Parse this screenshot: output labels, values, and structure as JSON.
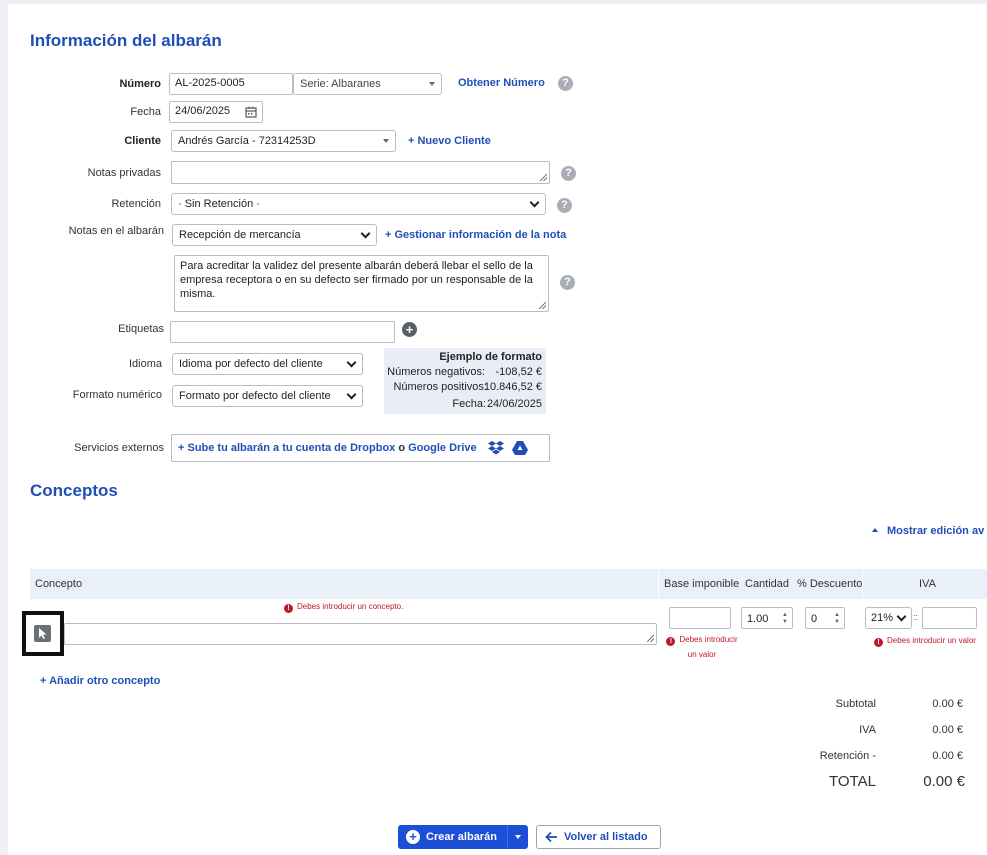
{
  "section_info": {
    "title": "Información del albarán"
  },
  "numero": {
    "label": "Número",
    "value": "AL-2025-0005",
    "serie": "Serie: Albaranes",
    "obtener": "Obtener Número"
  },
  "fecha": {
    "label": "Fecha",
    "value": "24/06/2025"
  },
  "cliente": {
    "label": "Cliente",
    "value": "Andrés García - 72314253D",
    "nuevo": "+ Nuevo Cliente"
  },
  "notas_privadas": {
    "label": "Notas privadas",
    "value": ""
  },
  "retencion": {
    "label": "Retención",
    "value": "· Sin Retención ·"
  },
  "notas_albaran": {
    "label": "Notas en el albarán",
    "select": "Recepción de mercancía",
    "gestionar": "+ Gestionar información de la nota",
    "text": "Para acreditar la validez del presente albarán deberá llebar el sello de la empresa receptora o en su defecto ser firmado por un responsable de la misma."
  },
  "etiquetas": {
    "label": "Etiquetas",
    "value": ""
  },
  "idioma": {
    "label": "Idioma",
    "value": "Idioma por defecto del cliente"
  },
  "formato": {
    "label": "Formato numérico",
    "value": "Formato por defecto del cliente"
  },
  "ejemplo": {
    "title": "Ejemplo de formato",
    "negativos": "Números negativos:",
    "negativos_val": "-108,52 €",
    "positivos": "Números positivos:",
    "positivos_val": "10.846,52 €",
    "fecha": "Fecha:",
    "fecha_val": "24/06/2025"
  },
  "servicios": {
    "label": "Servicios externos",
    "prefix": "+ Sube tu albarán a tu cuenta de ",
    "dropbox": "Dropbox",
    "o": " o ",
    "gdrive": "Google Drive"
  },
  "conceptos": {
    "title": "Conceptos",
    "mostrar": "Mostrar edición av",
    "headers": {
      "concepto": "Concepto",
      "base": "Base imponible",
      "cantidad": "Cantidad",
      "descuento": "% Descuento",
      "iva": "IVA"
    },
    "error_concepto": "Debes introducir un concepto.",
    "error_valor_1": "Debes introducir",
    "error_valor_2": "un valor",
    "error_iva": "Debes introducir un valor",
    "cantidad": "1.00",
    "descuento": "0",
    "iva_sel": "21%",
    "iva_sep": "::",
    "add": "+ Añadir otro concepto"
  },
  "totales": {
    "subtotal_l": "Subtotal",
    "subtotal_v": "0.00 €",
    "iva_l": "IVA",
    "iva_v": "0.00 €",
    "ret_l": "Retención -",
    "ret_v": "0.00 €",
    "total_l": "TOTAL",
    "total_v": "0.00 €"
  },
  "actions": {
    "crear": "Crear albarán",
    "volver": "Volver al listado"
  }
}
